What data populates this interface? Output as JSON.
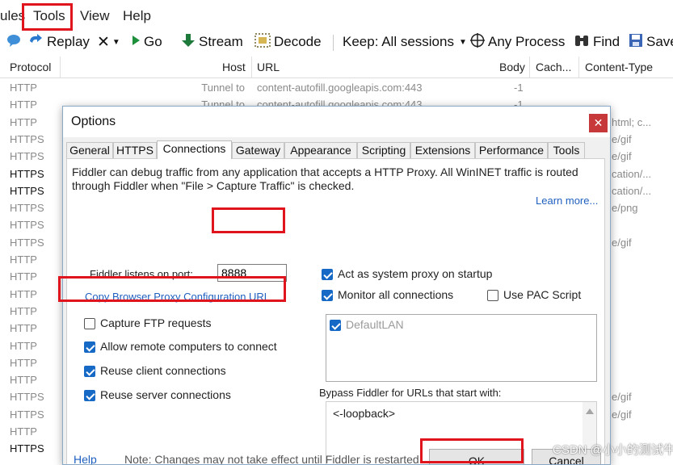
{
  "menu": {
    "items": [
      "ules",
      "Tools",
      "View",
      "Help"
    ]
  },
  "toolbar": {
    "replay": "Replay",
    "remove": "✕",
    "go": "Go",
    "stream": "Stream",
    "decode": "Decode",
    "keep": "Keep: All sessions",
    "any_process": "Any Process",
    "find": "Find",
    "save": "Save"
  },
  "sessions": {
    "columns": {
      "protocol": "Protocol",
      "host": "Host",
      "url": "URL",
      "body": "Body",
      "caching": "Cach...",
      "content_type": "Content-Type"
    },
    "rows": [
      {
        "protocol": "HTTP",
        "bold": false,
        "host": "Tunnel to",
        "url": "content-autofill.googleapis.com:443",
        "body": "-1",
        "ctype": ""
      },
      {
        "protocol": "HTTP",
        "bold": false,
        "host": "Tunnel to",
        "url": "content-autofill.googleapis.com:443",
        "body": "-1",
        "ctype": ""
      },
      {
        "protocol": "HTTP",
        "bold": false,
        "host": "",
        "url": "",
        "body": "",
        "ctype": "html; c..."
      },
      {
        "protocol": "HTTPS",
        "bold": false,
        "host": "",
        "url": "",
        "body": "",
        "ctype": "e/gif"
      },
      {
        "protocol": "HTTPS",
        "bold": false,
        "host": "",
        "url": "",
        "body": "",
        "ctype": "e/gif"
      },
      {
        "protocol": "HTTPS",
        "bold": true,
        "host": "",
        "url": "",
        "body": "",
        "ctype": "cation/..."
      },
      {
        "protocol": "HTTPS",
        "bold": true,
        "host": "",
        "url": "",
        "body": "",
        "ctype": "cation/..."
      },
      {
        "protocol": "HTTPS",
        "bold": false,
        "host": "",
        "url": "",
        "body": "",
        "ctype": "e/png"
      },
      {
        "protocol": "HTTPS",
        "bold": false,
        "host": "",
        "url": "",
        "body": "",
        "ctype": ""
      },
      {
        "protocol": "HTTPS",
        "bold": false,
        "host": "",
        "url": "",
        "body": "",
        "ctype": "e/gif"
      },
      {
        "protocol": "HTTP",
        "bold": false,
        "host": "",
        "url": "",
        "body": "",
        "ctype": ""
      },
      {
        "protocol": "HTTP",
        "bold": false,
        "host": "",
        "url": "",
        "body": "",
        "ctype": ""
      },
      {
        "protocol": "HTTP",
        "bold": false,
        "host": "",
        "url": "",
        "body": "",
        "ctype": ""
      },
      {
        "protocol": "HTTP",
        "bold": false,
        "host": "",
        "url": "",
        "body": "",
        "ctype": ""
      },
      {
        "protocol": "HTTP",
        "bold": false,
        "host": "",
        "url": "",
        "body": "",
        "ctype": ""
      },
      {
        "protocol": "HTTP",
        "bold": false,
        "host": "",
        "url": "",
        "body": "",
        "ctype": ""
      },
      {
        "protocol": "HTTP",
        "bold": false,
        "host": "",
        "url": "",
        "body": "",
        "ctype": ""
      },
      {
        "protocol": "HTTP",
        "bold": false,
        "host": "",
        "url": "",
        "body": "",
        "ctype": ""
      },
      {
        "protocol": "HTTPS",
        "bold": false,
        "host": "",
        "url": "",
        "body": "",
        "ctype": "e/gif"
      },
      {
        "protocol": "HTTPS",
        "bold": false,
        "host": "",
        "url": "",
        "body": "",
        "ctype": "e/gif"
      },
      {
        "protocol": "HTTP",
        "bold": false,
        "host": "",
        "url": "",
        "body": "",
        "ctype": ""
      },
      {
        "protocol": "HTTPS",
        "bold": true,
        "host": "",
        "url": "",
        "body": "",
        "ctype": ""
      }
    ]
  },
  "dialog": {
    "title": "Options",
    "close": "✕",
    "tabs": [
      "General",
      "HTTPS",
      "Connections",
      "Gateway",
      "Appearance",
      "Scripting",
      "Extensions",
      "Performance",
      "Tools"
    ],
    "active_tab": "Connections",
    "description_line1": "Fiddler can debug traffic from any application that accepts a HTTP Proxy. All WinINET traffic is routed",
    "description_line2": "through Fiddler when \"File > Capture Traffic\" is checked.",
    "learn_more": "Learn more...",
    "port_label": "Fiddler listens on port:",
    "port_value": "8888",
    "copy_proxy_link": "Copy Browser Proxy Configuration URL",
    "capture_ftp": "Capture FTP requests",
    "allow_remote": "Allow remote computers to connect",
    "reuse_client": "Reuse client connections",
    "reuse_server": "Reuse server connections",
    "act_as_proxy": "Act as system proxy on startup",
    "monitor_all": "Monitor all connections",
    "use_pac": "Use PAC Script",
    "lan_item": "DefaultLAN",
    "bypass_label": "Bypass Fiddler for URLs that start with:",
    "bypass_value": "<-loopback>",
    "help": "Help",
    "note": "Note: Changes may not take effect until Fiddler is restarted.",
    "ok": "OK",
    "cancel": "Cancel"
  },
  "watermark": "CSDN @小小的测试牛",
  "colors": {
    "accent": "#1769c6",
    "highlight": "#e0141c",
    "close": "#c7383a",
    "link": "#1f5fbf"
  }
}
